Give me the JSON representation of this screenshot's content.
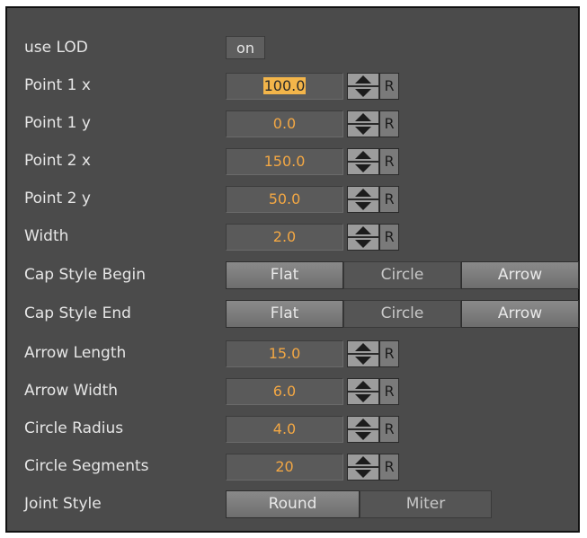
{
  "rows": [
    {
      "label": "use LOD",
      "type": "toggle",
      "value": "on"
    },
    {
      "label": "Point 1 x",
      "type": "number",
      "value_sel": "100.0",
      "reset": "R"
    },
    {
      "label": "Point 1 y",
      "type": "number",
      "value": "0.0",
      "reset": "R"
    },
    {
      "label": "Point 2 x",
      "type": "number",
      "value": "150.0",
      "reset": "R"
    },
    {
      "label": "Point 2 y",
      "type": "number",
      "value": "50.0",
      "reset": "R"
    },
    {
      "label": "Width",
      "type": "number",
      "value": "2.0",
      "reset": "R"
    },
    {
      "label": "Cap Style Begin",
      "type": "segmented",
      "options": [
        "Flat",
        "Circle",
        "Arrow"
      ],
      "selected": "Circle"
    },
    {
      "label": "Cap Style End",
      "type": "segmented",
      "options": [
        "Flat",
        "Circle",
        "Arrow"
      ],
      "selected": "Circle"
    },
    {
      "label": "Arrow Length",
      "type": "number",
      "value": "15.0",
      "reset": "R"
    },
    {
      "label": "Arrow Width",
      "type": "number",
      "value": "6.0",
      "reset": "R"
    },
    {
      "label": "Circle Radius",
      "type": "number",
      "value": "4.0",
      "reset": "R"
    },
    {
      "label": "Circle Segments",
      "type": "number",
      "value": "20",
      "reset": "R"
    },
    {
      "label": "Joint Style",
      "type": "segmented",
      "options": [
        "Round",
        "Miter"
      ],
      "selected": "Miter"
    }
  ],
  "colors": {
    "panel_bg": "#4b4b4b",
    "label_text": "#e6e6e6",
    "value_text": "#f2a744",
    "selection_highlight": "#f3b54a"
  },
  "icons": {
    "spinner": "up-down-arrows-icon"
  }
}
